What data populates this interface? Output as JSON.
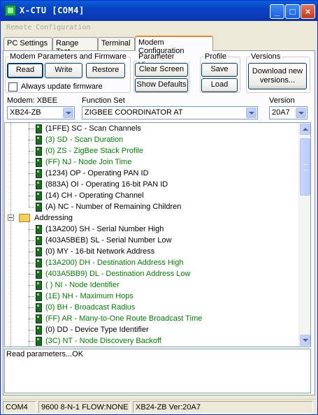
{
  "window": {
    "title": "X-CTU  [COM4]",
    "minimize": "_",
    "maximize": "□",
    "close": "×"
  },
  "remote_config": "Remote Configuration",
  "tabs": [
    "PC Settings",
    "Range Test",
    "Terminal",
    "Modem Configuration"
  ],
  "groups": {
    "modem_params": {
      "legend": "Modem Parameters and Firmware",
      "read": "Read",
      "write": "Write",
      "restore": "Restore",
      "always_update": "Always update firmware"
    },
    "param_view": {
      "legend": "Parameter View",
      "clear_screen": "Clear Screen",
      "show_defaults": "Show Defaults"
    },
    "profile": {
      "legend": "Profile",
      "save": "Save",
      "load": "Load"
    },
    "versions": {
      "legend": "Versions",
      "download": "Download new versions..."
    }
  },
  "selectors": {
    "modem_label": "Modem: XBEE",
    "modem_value": "XB24-ZB",
    "function_label": "Function Set",
    "function_value": "ZIGBEE COORDINATOR AT",
    "version_label": "Version",
    "version_value": "20A7"
  },
  "tree": {
    "rows_top": [
      {
        "text": "(1FFE) SC - Scan Channels",
        "green": false
      },
      {
        "text": "(3) SD - Scan Duration",
        "green": true
      },
      {
        "text": "(0) ZS - ZigBee Stack Profile",
        "green": true
      },
      {
        "text": "(FF) NJ - Node Join Time",
        "green": true
      },
      {
        "text": "(1234) OP - Operating PAN ID",
        "green": false
      },
      {
        "text": "(883A) OI - Operating 16-bit PAN ID",
        "green": false
      },
      {
        "text": "(14) CH - Operating Channel",
        "green": false
      },
      {
        "text": "(A) NC - Number of Remaining Children",
        "green": false
      }
    ],
    "folder": "Addressing",
    "rows_addr": [
      {
        "text": "(13A200) SH - Serial Number High",
        "green": false
      },
      {
        "text": "(403A5BEB) SL - Serial Number Low",
        "green": false
      },
      {
        "text": "(0) MY - 16-bit Network Address",
        "green": false
      },
      {
        "text": "(13A200) DH - Destination Address High",
        "green": true
      },
      {
        "text": "(403A5BB9) DL - Destination Address Low",
        "green": true
      },
      {
        "text": "( ) NI - Node Identifier",
        "green": true
      },
      {
        "text": "(1E) NH - Maximum Hops",
        "green": true
      },
      {
        "text": "(0) BH - Broadcast Radius",
        "green": true
      },
      {
        "text": "(FF) AR - Many-to-One Route Broadcast Time",
        "green": true
      },
      {
        "text": "(0) DD - Device Type Identifier",
        "green": false
      },
      {
        "text": "(3C) NT - Node Discovery Backoff",
        "green": true
      }
    ]
  },
  "status_message": "Read parameters...OK",
  "statusbar": {
    "port": "COM4",
    "settings": "9600 8-N-1  FLOW:NONE",
    "modem": "XB24-ZB  Ver:20A7"
  }
}
